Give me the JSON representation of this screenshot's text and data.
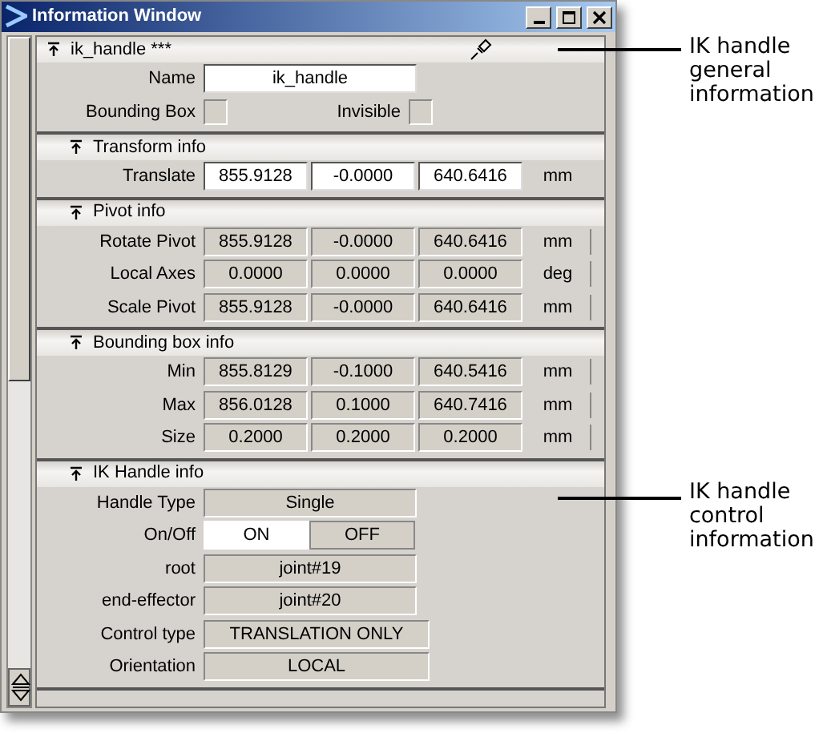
{
  "window": {
    "title": "Information Window"
  },
  "sections": [
    {
      "title": "ik_handle ***",
      "pin": true,
      "rows": [
        {
          "kind": "text",
          "label": "Name",
          "value": "ik_handle"
        },
        {
          "kind": "checks",
          "items": [
            {
              "label": "Bounding Box",
              "checked": false
            },
            {
              "label": "Invisible",
              "checked": false
            }
          ]
        }
      ]
    },
    {
      "title": "Transform info",
      "pin": false,
      "rows": [
        {
          "kind": "vector",
          "label": "Translate",
          "values": [
            "855.9128",
            "-0.0000",
            "640.6416"
          ],
          "unit": "mm",
          "editable": true
        }
      ]
    },
    {
      "title": "Pivot info",
      "pin": false,
      "rows": [
        {
          "kind": "vector",
          "label": "Rotate Pivot",
          "values": [
            "855.9128",
            "-0.0000",
            "640.6416"
          ],
          "unit": "mm",
          "editable": false
        },
        {
          "kind": "vector",
          "label": "Local Axes",
          "values": [
            "0.0000",
            "0.0000",
            "0.0000"
          ],
          "unit": "deg",
          "editable": false
        },
        {
          "kind": "vector",
          "label": "Scale Pivot",
          "values": [
            "855.9128",
            "-0.0000",
            "640.6416"
          ],
          "unit": "mm",
          "editable": false
        }
      ]
    },
    {
      "title": "Bounding box info",
      "pin": false,
      "rows": [
        {
          "kind": "vector",
          "label": "Min",
          "values": [
            "855.8129",
            "-0.1000",
            "640.5416"
          ],
          "unit": "mm",
          "editable": false
        },
        {
          "kind": "vector",
          "label": "Max",
          "values": [
            "856.0128",
            "0.1000",
            "640.7416"
          ],
          "unit": "mm",
          "editable": false
        },
        {
          "kind": "vector",
          "label": "Size",
          "values": [
            "0.2000",
            "0.2000",
            "0.2000"
          ],
          "unit": "mm",
          "editable": false
        }
      ]
    },
    {
      "title": "IK Handle info",
      "pin": false,
      "rows": [
        {
          "kind": "value",
          "label": "Handle Type",
          "value": "Single",
          "wide": false
        },
        {
          "kind": "toggle",
          "label": "On/Off",
          "options": [
            {
              "label": "ON",
              "selected": true
            },
            {
              "label": "OFF",
              "selected": false
            }
          ]
        },
        {
          "kind": "value",
          "label": "root",
          "value": "joint#19",
          "wide": false
        },
        {
          "kind": "value",
          "label": "end-effector",
          "value": "joint#20",
          "wide": false
        },
        {
          "kind": "value",
          "label": "Control type",
          "value": "TRANSLATION ONLY",
          "wide": true
        },
        {
          "kind": "value",
          "label": "Orientation",
          "value": "LOCAL",
          "wide": true
        }
      ]
    }
  ],
  "annotations": [
    {
      "text": "IK handle general information"
    },
    {
      "text": "IK handle control information"
    }
  ]
}
